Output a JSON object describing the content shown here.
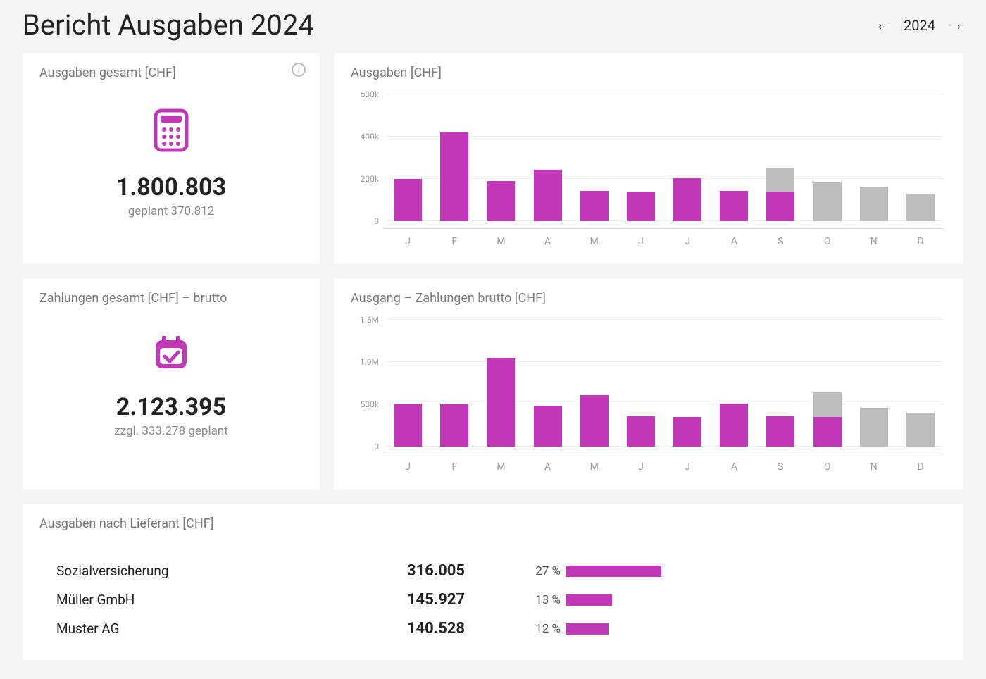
{
  "header": {
    "title": "Bericht Ausgaben 2024",
    "year": "2024"
  },
  "kpi_expenses": {
    "title": "Ausgaben gesamt [CHF]",
    "value": "1.800.803",
    "sub": "geplant 370.812"
  },
  "kpi_payments": {
    "title": "Zahlungen gesamt [CHF] – brutto",
    "value": "2.123.395",
    "sub": "zzgl. 333.278 geplant"
  },
  "chart_expenses_title": "Ausgaben [CHF]",
  "chart_payments_title": "Ausgang – Zahlungen brutto [CHF]",
  "suppliers": {
    "title": "Ausgaben nach Lieferant [CHF]",
    "rows": [
      {
        "name": "Sozialversicherung",
        "value": "316.005",
        "pct_label": "27 %",
        "pct": 27
      },
      {
        "name": "Müller GmbH",
        "value": "145.927",
        "pct_label": "13 %",
        "pct": 13
      },
      {
        "name": "Muster AG",
        "value": "140.528",
        "pct_label": "12 %",
        "pct": 12
      }
    ]
  },
  "chart_data": [
    {
      "id": "expenses",
      "type": "bar",
      "title": "Ausgaben [CHF]",
      "categories": [
        "J",
        "F",
        "M",
        "A",
        "M",
        "J",
        "J",
        "A",
        "S",
        "O",
        "N",
        "D"
      ],
      "series": [
        {
          "name": "actual",
          "values": [
            200000,
            420000,
            190000,
            245000,
            145000,
            140000,
            205000,
            145000,
            140000,
            null,
            null,
            null
          ]
        },
        {
          "name": "planned",
          "values": [
            null,
            null,
            null,
            null,
            null,
            null,
            null,
            null,
            255000,
            185000,
            165000,
            130000
          ]
        }
      ],
      "ylim": [
        0,
        600000
      ],
      "yticks": [
        0,
        200000,
        400000,
        600000
      ],
      "ytick_labels": [
        "0",
        "200k",
        "400k",
        "600k"
      ]
    },
    {
      "id": "payments",
      "type": "bar",
      "title": "Ausgang – Zahlungen brutto [CHF]",
      "categories": [
        "J",
        "F",
        "M",
        "A",
        "M",
        "J",
        "J",
        "A",
        "S",
        "O",
        "N",
        "D"
      ],
      "series": [
        {
          "name": "actual",
          "values": [
            500000,
            500000,
            1050000,
            480000,
            610000,
            360000,
            350000,
            510000,
            360000,
            350000,
            null,
            null
          ]
        },
        {
          "name": "planned",
          "values": [
            null,
            null,
            null,
            null,
            null,
            null,
            null,
            null,
            null,
            640000,
            460000,
            400000
          ]
        }
      ],
      "ylim": [
        0,
        1500000
      ],
      "yticks": [
        0,
        500000,
        1000000,
        1500000
      ],
      "ytick_labels": [
        "0",
        "500k",
        "1.0M",
        "1.5M"
      ]
    }
  ]
}
